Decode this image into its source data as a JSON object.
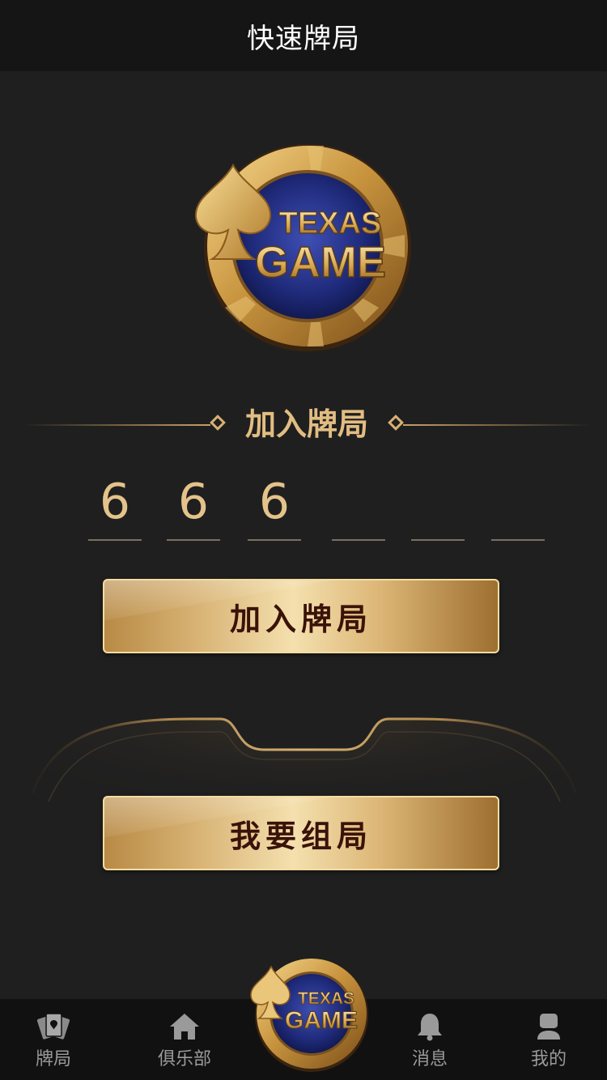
{
  "header": {
    "title": "快速牌局"
  },
  "logo": {
    "line1": "TEXAS",
    "line2": "GAME"
  },
  "join": {
    "section_title": "加入牌局",
    "digits": [
      "6",
      "6",
      "6",
      "",
      "",
      ""
    ],
    "button_label": "加入牌局"
  },
  "create": {
    "button_label": "我要组局"
  },
  "tabbar": {
    "items": [
      {
        "label": "牌局",
        "icon": "cards-icon"
      },
      {
        "label": "俱乐部",
        "icon": "home-icon"
      },
      {
        "label": "",
        "icon": "texas-game-logo-icon"
      },
      {
        "label": "消息",
        "icon": "bell-icon"
      },
      {
        "label": "我的",
        "icon": "user-icon"
      }
    ]
  },
  "colors": {
    "gold": "#e2bd82",
    "background": "#1f1f1f",
    "navy": "#24307a"
  }
}
